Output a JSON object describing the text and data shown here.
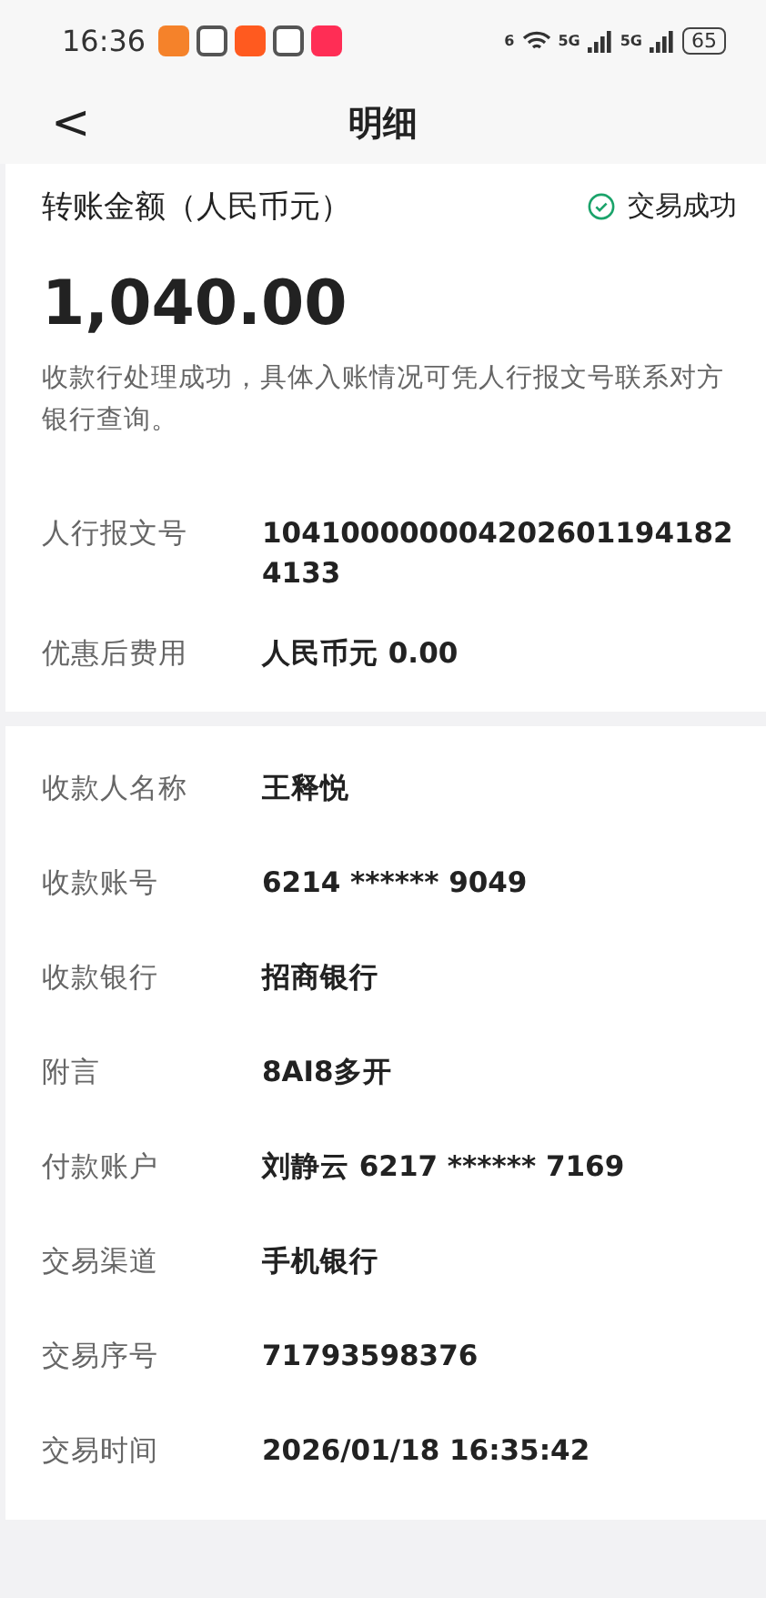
{
  "status_bar": {
    "time": "16:36",
    "wifi_label": "6",
    "network_labels": [
      "5G",
      "5G"
    ],
    "battery": "65"
  },
  "header": {
    "back": "<",
    "title": "明细"
  },
  "summary": {
    "label": "转账金额（人民币元）",
    "status": "交易成功",
    "amount": "1,040.00",
    "note": "收款行处理成功，具体入账情况可凭人行报文号联系对方银行查询。",
    "rows": [
      {
        "label": "人行报文号",
        "value": "104100000004202601194182 4133"
      },
      {
        "label": "优惠后费用",
        "value": "人民币元 0.00"
      }
    ]
  },
  "details": [
    {
      "label": "收款人名称",
      "value": "王释悦"
    },
    {
      "label": "收款账号",
      "value": "6214 ****** 9049"
    },
    {
      "label": "收款银行",
      "value": "招商银行"
    },
    {
      "label": "附言",
      "value": "8AI8多开"
    },
    {
      "label": "付款账户",
      "value": "刘静云 6217 ****** 7169"
    },
    {
      "label": "交易渠道",
      "value": "手机银行"
    },
    {
      "label": "交易序号",
      "value": "71793598376"
    },
    {
      "label": "交易时间",
      "value": "2026/01/18 16:35:42"
    }
  ]
}
